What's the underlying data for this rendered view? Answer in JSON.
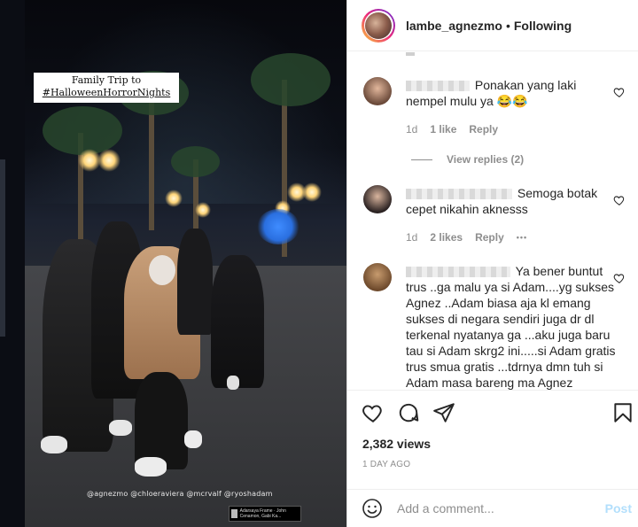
{
  "post": {
    "username": "lambe_agnezmo",
    "separator": "•",
    "follow_status": "Following"
  },
  "video": {
    "caption_line1": "Family Trip to",
    "caption_line2": "#HalloweenHorrorNights",
    "tags": "@agnezmo @chloeraviera @mcrvalf @ryoshadam",
    "music_text": "Adarsaya Frame · John Cenamon, Gabi Ka..."
  },
  "comments": [
    {
      "text": "Ponakan yang laki nempel mulu ya 😂😂",
      "age": "1d",
      "likes": "1 like",
      "reply": "Reply",
      "view_replies": "View replies (2)"
    },
    {
      "text": "Semoga botak cepet nikahin aknesss",
      "age": "1d",
      "likes": "2 likes",
      "reply": "Reply",
      "more": "•••"
    },
    {
      "text": "Ya bener buntut trus ..ga malu ya si Adam....yg sukses Agnez ..Adam biasa aja kl emang sukses di negara sendiri juga dr dl terkenal nyatanya ga ...aku juga baru tau si Adam skrg2 ini.....si Adam gratis trus smua gratis ...tdrnya dmn tuh si Adam masa bareng ma Agnez"
    }
  ],
  "stats": {
    "views": "2,382 views",
    "time_ago": "1 DAY AGO"
  },
  "composer": {
    "placeholder": "Add a comment...",
    "post_label": "Post"
  },
  "colors": {
    "accent_disabled": "#b2dffc",
    "muted_text": "#8e8e8e",
    "primary_text": "#262626"
  },
  "icons": [
    "heart-icon",
    "comment-icon",
    "share-icon",
    "bookmark-icon",
    "emoji-icon",
    "more-icon"
  ]
}
